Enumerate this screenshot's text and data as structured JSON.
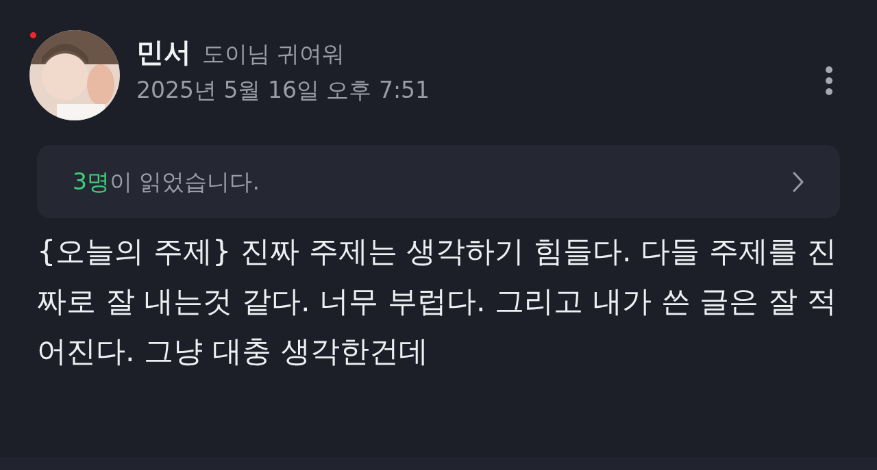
{
  "post": {
    "author": "민서",
    "status_message": "도이님 귀여워",
    "unread": true,
    "timestamp": "2025년 5월 16일 오후 7:51"
  },
  "read_receipt": {
    "count": "3명",
    "text": "이 읽었습니다."
  },
  "body": "{오늘의 주제} 진짜 주제는 생각하기 힘들다. 다들 주제를 진짜로 잘 내는것 같다. 너무 부럽다. 그리고 내가 쓴 글은 잘 적어진다. 그냥 대충 생각한건데"
}
